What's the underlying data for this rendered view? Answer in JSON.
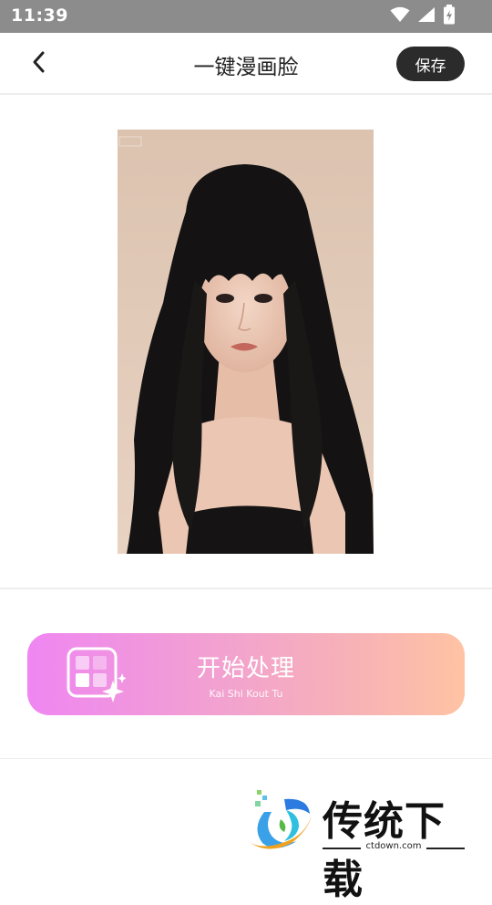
{
  "status_bar": {
    "time": "11:39",
    "icons": [
      "wifi-icon",
      "signal-icon",
      "battery-charging-icon"
    ]
  },
  "header": {
    "title": "一键漫画脸",
    "back_icon": "chevron-left-icon",
    "save_label": "保存"
  },
  "photo": {
    "description_icon": "portrait-photo"
  },
  "action": {
    "start_label": "开始处理",
    "start_sublabel": "Kai Shi Kout Tu",
    "icon": "sparkle-grid-icon",
    "gradient": [
      "#ef86f2",
      "#ffc3a3"
    ]
  },
  "watermark": {
    "brand": "传统下载",
    "url": "ctdown.com"
  },
  "colors": {
    "status_bar": "#8c8c8c",
    "save_button": "#2b2b2b",
    "divider": "#eeeeee"
  }
}
